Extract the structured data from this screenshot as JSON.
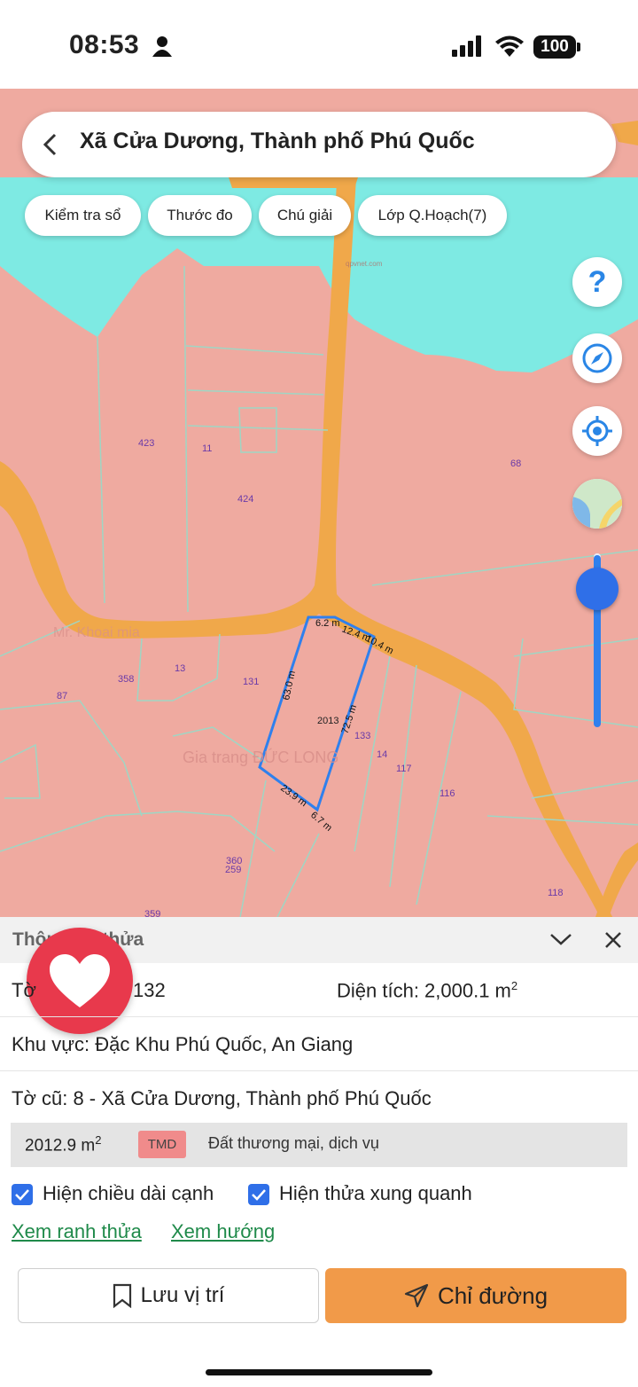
{
  "status_bar": {
    "time": "08:53",
    "battery": "100"
  },
  "search": {
    "title": "Xã Cửa Dương, Thành phố Phú Quốc"
  },
  "chips": [
    "Kiểm tra sổ",
    "Thước đo",
    "Chú giải",
    "Lớp Q.Hoạch(7)"
  ],
  "map_controls": {
    "help_label": "?"
  },
  "map": {
    "parcel_labels": [
      "423",
      "11",
      "424",
      "68",
      "358",
      "13",
      "131",
      "87",
      "2013",
      "133",
      "14",
      "117",
      "116",
      "360",
      "259",
      "118",
      "359"
    ],
    "edge_labels": [
      "6.2 m",
      "12.4 m",
      "10.4 m",
      "63.0 m",
      "72.5 m",
      "23.9 m",
      "6.7 m"
    ],
    "watermarks": [
      "Gia trang ĐỨC LONG",
      "Mr. Khoai mia",
      "qpvnet.com"
    ],
    "colors": {
      "land": "#efaaa0",
      "water": "#7eeae3",
      "road": "#f0a84a",
      "boundary": "#2f80ed"
    }
  },
  "panel": {
    "header_title": "Thông tin thửa",
    "sheet_label": "Tờ",
    "sheet_value": "132",
    "area_label": "Diện tích: 2,000.1 m",
    "area_sup": "2",
    "region": "Khu vực: Đặc Khu Phú Quốc, An Giang",
    "old_sheet": "Tờ cũ: 8 - Xã Cửa Dương, Thành phố Phú Quốc",
    "land_use": {
      "area": "2012.9 m",
      "area_sup": "2",
      "code": "TMD",
      "type": "Đất thương mại, dịch vụ"
    },
    "checkbox_edge_length": "Hiện chiều dài cạnh",
    "checkbox_neighbors": "Hiện thửa xung quanh",
    "link_boundary": "Xem ranh thửa",
    "link_direction": "Xem hướng",
    "button_save": "Lưu vị trí",
    "button_route": "Chỉ đường"
  }
}
